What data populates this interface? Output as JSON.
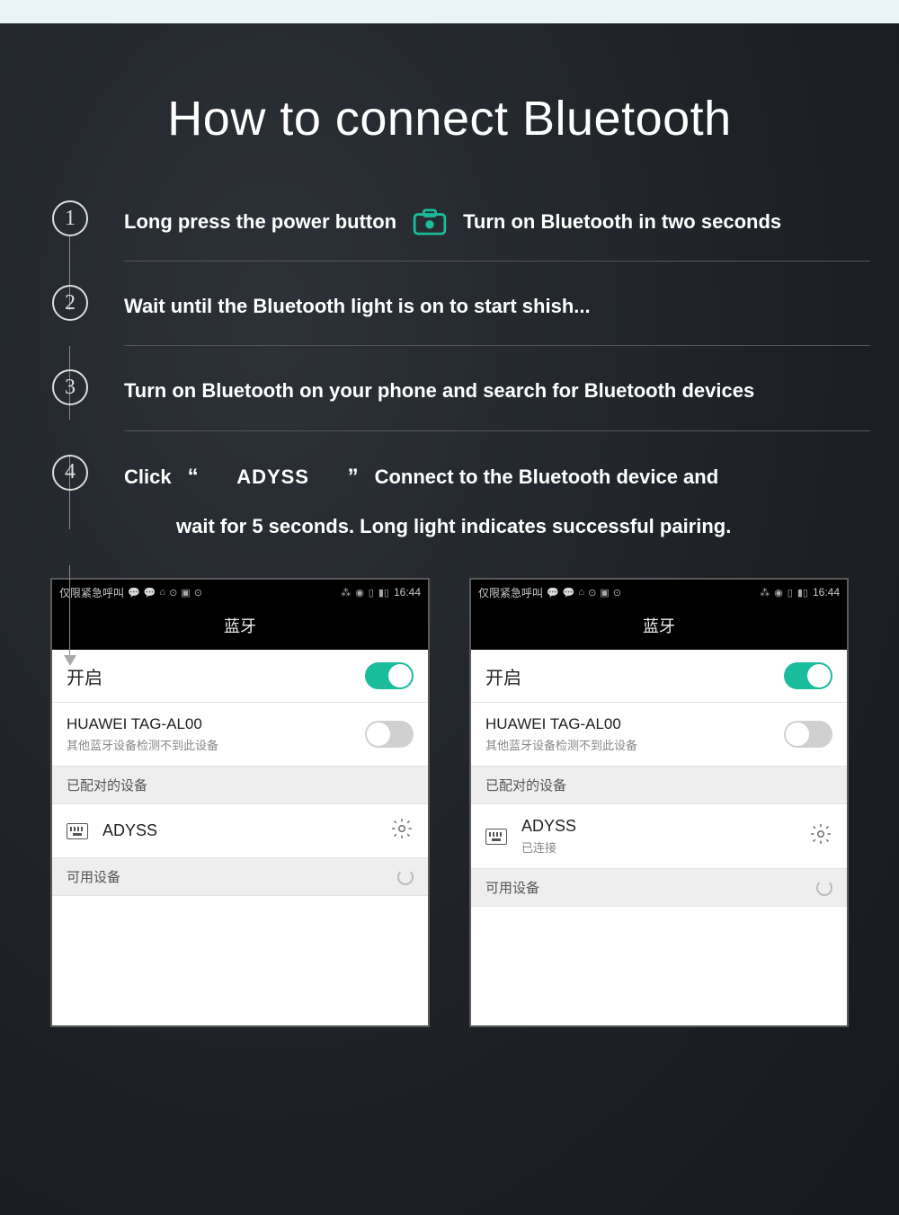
{
  "title": "How to connect Bluetooth",
  "steps": {
    "s1": {
      "num": "1",
      "a": "Long press the power button",
      "b": "Turn on Bluetooth in two seconds"
    },
    "s2": {
      "num": "2",
      "text": "Wait until the Bluetooth light is on to start shish..."
    },
    "s3": {
      "num": "3",
      "text": "Turn on Bluetooth on your phone and search for Bluetooth devices"
    },
    "s4": {
      "num": "4",
      "a": "Click",
      "q1": "“",
      "dev": "ADYSS",
      "q2": "”",
      "b": "Connect to the Bluetooth device and",
      "c": "wait for 5 seconds. Long light indicates successful pairing."
    }
  },
  "phone": {
    "status_left": "仅限紧急呼叫",
    "status_time": "16:44",
    "screen_title": "蓝牙",
    "enable_label": "开启",
    "device_name": "HUAWEI TAG-AL00",
    "device_sub": "其他蓝牙设备检测不到此设备",
    "paired_header": "已配对的设备",
    "available_header": "可用设备",
    "adyss": "ADYSS",
    "connected": "已连接"
  }
}
